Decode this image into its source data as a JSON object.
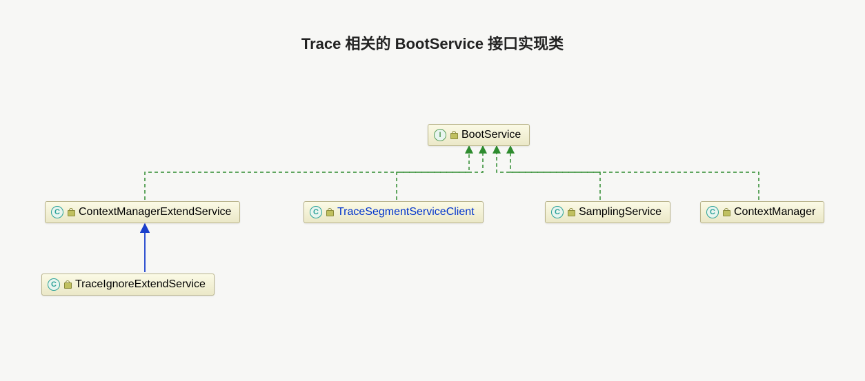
{
  "title": "Trace 相关的 BootService 接口实现类",
  "nodes": {
    "bootService": {
      "type": "I",
      "label": "BootService"
    },
    "contextManagerExtend": {
      "type": "C",
      "label": "ContextManagerExtendService"
    },
    "traceSegment": {
      "type": "C",
      "label": "TraceSegmentServiceClient"
    },
    "samplingService": {
      "type": "C",
      "label": "SamplingService"
    },
    "contextManager": {
      "type": "C",
      "label": "ContextManager"
    },
    "traceIgnore": {
      "type": "C",
      "label": "TraceIgnoreExtendService"
    }
  },
  "relations": [
    {
      "from": "contextManagerExtend",
      "to": "bootService",
      "kind": "implements"
    },
    {
      "from": "traceSegment",
      "to": "bootService",
      "kind": "implements"
    },
    {
      "from": "samplingService",
      "to": "bootService",
      "kind": "implements"
    },
    {
      "from": "contextManager",
      "to": "bootService",
      "kind": "implements"
    },
    {
      "from": "traceIgnore",
      "to": "contextManagerExtend",
      "kind": "extends"
    }
  ]
}
